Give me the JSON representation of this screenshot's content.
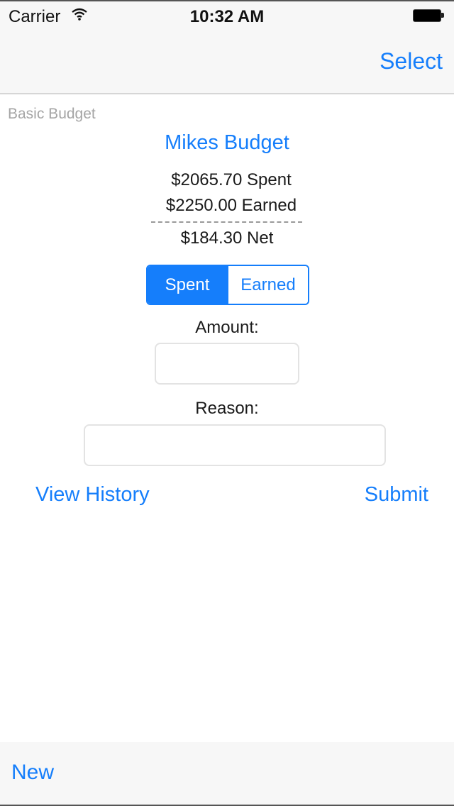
{
  "status_bar": {
    "carrier": "Carrier",
    "wifi_icon": "wifi-icon",
    "time": "10:32 AM",
    "battery_icon": "battery-full-icon"
  },
  "nav_bar": {
    "right_button": "Select"
  },
  "main": {
    "section_label": "Basic Budget",
    "budget_name": "Mikes Budget",
    "summary": {
      "spent": "$2065.70 Spent",
      "earned": "$2250.00 Earned",
      "net": "$184.30 Net"
    },
    "segmented_control": {
      "options": [
        "Spent",
        "Earned"
      ],
      "selected": "Spent"
    },
    "amount": {
      "label": "Amount:",
      "value": "",
      "placeholder": ""
    },
    "reason": {
      "label": "Reason:",
      "value": "",
      "placeholder": ""
    },
    "view_history_label": "View History",
    "submit_label": "Submit"
  },
  "toolbar": {
    "new_label": "New"
  },
  "colors": {
    "accent": "#157efb",
    "bar_background": "#f7f7f7",
    "secondary_text": "#a5a5a5"
  }
}
